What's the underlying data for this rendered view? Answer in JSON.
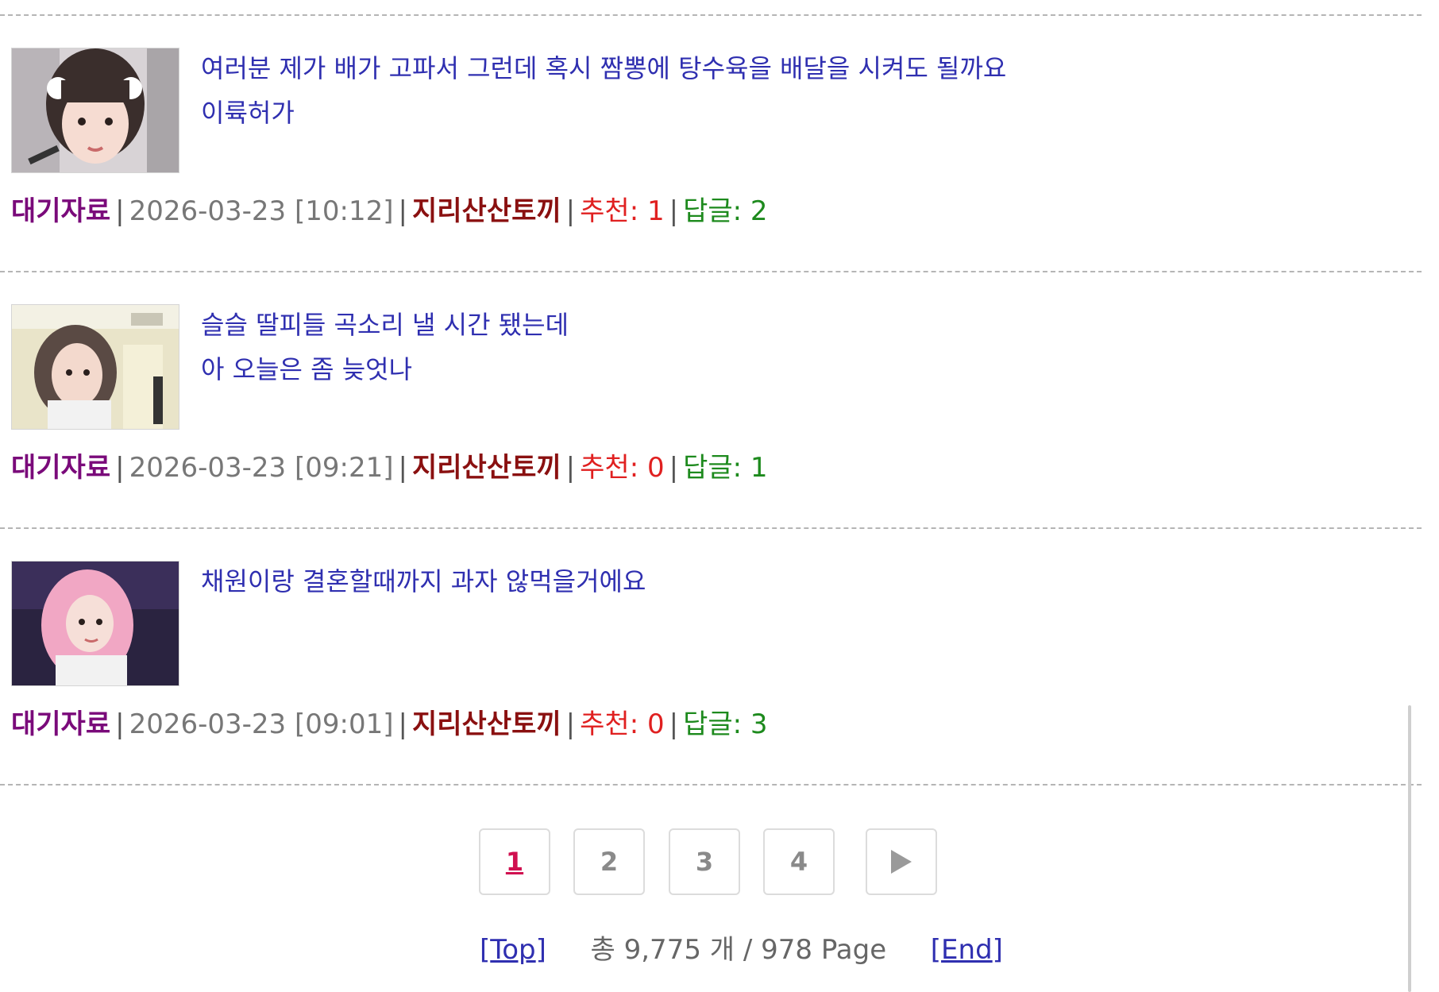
{
  "posts": [
    {
      "title_lines": [
        "여러분 제가 배가 고파서 그런데 혹시 짬뽕에 탕수육을 배달을 시켜도 될까요",
        "이륙허가"
      ],
      "category": "대기자료",
      "date": "2026-03-23 [10:12]",
      "author": "지리산산토끼",
      "recommend_label": "추천:",
      "recommend": "1",
      "reply_label": "답글:",
      "reply": "2"
    },
    {
      "title_lines": [
        "슬슬 딸피들 곡소리 낼 시간 됐는데",
        "아 오늘은 좀 늦엇나"
      ],
      "category": "대기자료",
      "date": "2026-03-23 [09:21]",
      "author": "지리산산토끼",
      "recommend_label": "추천:",
      "recommend": "0",
      "reply_label": "답글:",
      "reply": "1"
    },
    {
      "title_lines": [
        "채원이랑 결혼할때까지 과자 않먹을거에요",
        ""
      ],
      "category": "대기자료",
      "date": "2026-03-23 [09:01]",
      "author": "지리산산토끼",
      "recommend_label": "추천:",
      "recommend": "0",
      "reply_label": "답글:",
      "reply": "3"
    }
  ],
  "separator": "|",
  "pagination": {
    "pages": [
      "1",
      "2",
      "3",
      "4"
    ],
    "current": "1",
    "next_icon": "play-arrow-icon"
  },
  "footer": {
    "top_link": "Top",
    "bracket_open": "[",
    "bracket_close": "]",
    "total_text": "총 9,775 개 / 978 Page",
    "end_link": "End"
  },
  "colors": {
    "title": "#2f2fb0",
    "category": "#7a0a7a",
    "author": "#8a1010",
    "recommend": "#e02020",
    "reply": "#1d8a1d",
    "current_page": "#d01050"
  }
}
